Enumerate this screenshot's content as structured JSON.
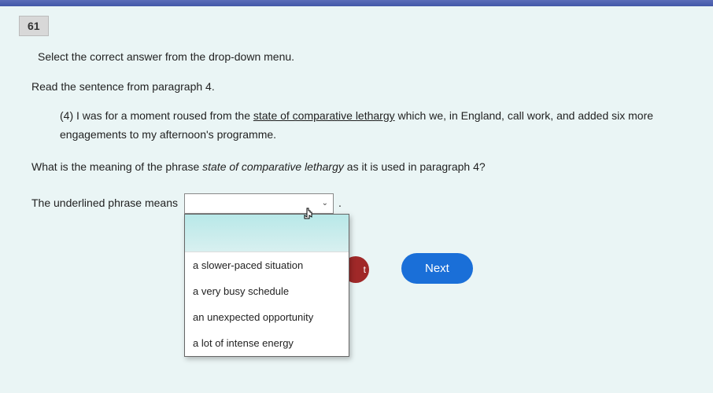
{
  "question_number": "61",
  "instruction": "Select the correct answer from the drop-down menu.",
  "read_sentence": "Read the sentence from paragraph 4.",
  "quote": {
    "prefix": "(4) I was for a moment roused from the ",
    "underlined": "state of comparative lethargy",
    "suffix": " which we, in England, call work, and added six more engagements to my afternoon's programme."
  },
  "prompt": {
    "before": "What is the meaning of the phrase ",
    "italic": "state of comparative lethargy",
    "after": " as it is used in paragraph 4?"
  },
  "answer_label": "The underlined phrase means",
  "period": ".",
  "dropdown": {
    "options": [
      "a slower-paced situation",
      "a very busy schedule",
      "an unexpected opportunity",
      "a lot of intense energy"
    ]
  },
  "hidden_btn_fragment": "t",
  "next_label": "Next"
}
